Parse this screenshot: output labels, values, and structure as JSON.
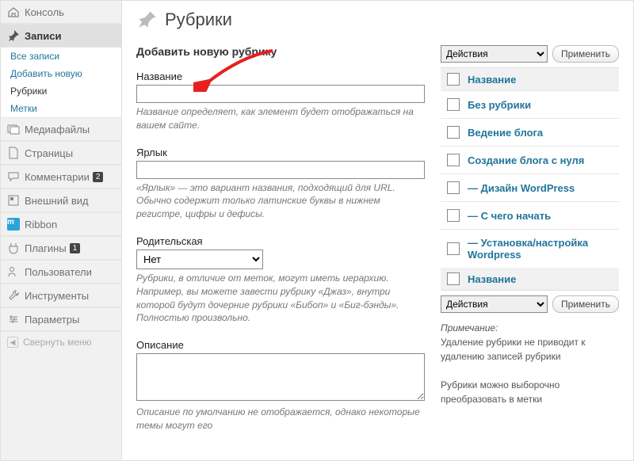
{
  "page": {
    "title": "Рубрики"
  },
  "sidebar": {
    "console": "Консоль",
    "posts": "Записи",
    "sub_all": "Все записи",
    "sub_new": "Добавить новую",
    "sub_cat": "Рубрики",
    "sub_tag": "Метки",
    "media": "Медиафайлы",
    "pages": "Страницы",
    "comments": "Комментарии",
    "comments_count": "2",
    "appearance": "Внешний вид",
    "ribbon": "Ribbon",
    "ribbon_m": "m",
    "plugins": "Плагины",
    "plugins_count": "1",
    "users": "Пользователи",
    "tools": "Инструменты",
    "settings": "Параметры",
    "collapse": "Свернуть меню"
  },
  "form": {
    "heading": "Добавить новую рубрику",
    "name_label": "Название",
    "name_desc": "Название определяет, как элемент будет отображаться на вашем сайте.",
    "slug_label": "Ярлык",
    "slug_desc": "«Ярлык» — это вариант названия, подходящий для URL. Обычно содержит только латинские буквы в нижнем регистре, цифры и дефисы.",
    "parent_label": "Родительская",
    "parent_value": "Нет",
    "parent_desc": "Рубрики, в отличие от меток, могут иметь иерархию. Например, вы можете завести рубрику «Джаз», внутри которой будут дочерние рубрики «Бибоп» и «Биг-бэнды». Полностью произвольно.",
    "desc_label": "Описание",
    "desc_desc": "Описание по умолчанию не отображается, однако некоторые темы могут его"
  },
  "list": {
    "bulk": "Действия",
    "apply": "Применить",
    "col_name": "Название",
    "rows": [
      "Без рубрики",
      "Ведение блога",
      "Создание блога с нуля",
      "— Дизайн WordPress",
      "— С чего начать",
      "— Установка/настройка Wordpress"
    ],
    "note1": "Примечание:",
    "note2": "Удаление рубрики не приводит к удалению записей рубрики",
    "note3": "Рубрики можно выборочно преобразовать в метки"
  }
}
